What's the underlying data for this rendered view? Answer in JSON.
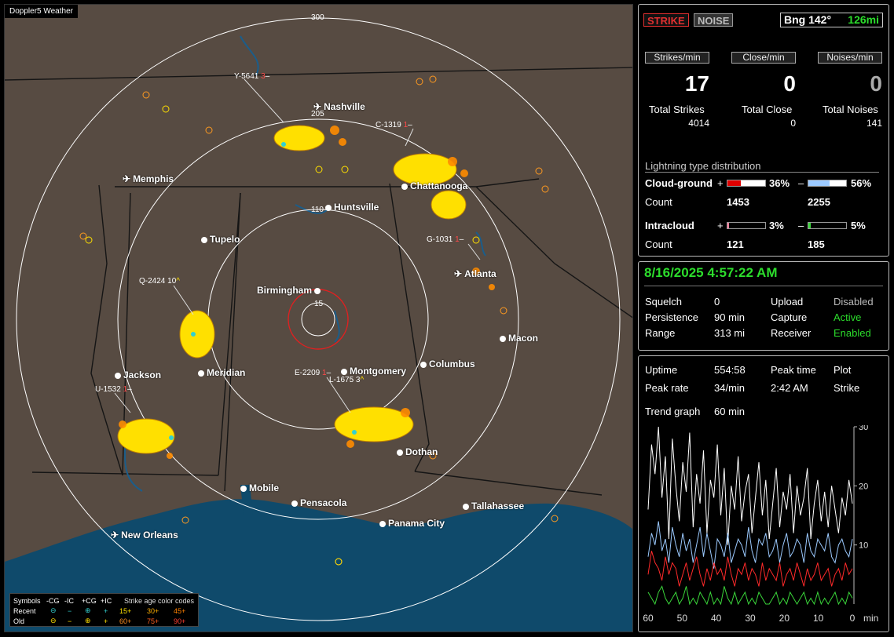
{
  "app": {
    "title": "Doppler5 Weather"
  },
  "map": {
    "ring_labels": {
      "r15": "15",
      "r110": "110",
      "r205": "205",
      "r300": "300"
    },
    "cities": [
      {
        "name": "Nashville",
        "icon": "airport-icon"
      },
      {
        "name": "Memphis",
        "icon": "airport-icon"
      },
      {
        "name": "Chattanooga",
        "icon": "city-dot"
      },
      {
        "name": "Huntsville",
        "icon": "city-dot"
      },
      {
        "name": "Tupelo",
        "icon": "city-dot"
      },
      {
        "name": "Birmingham",
        "icon": "city-dot"
      },
      {
        "name": "Atlanta",
        "icon": "airport-icon"
      },
      {
        "name": "Macon",
        "icon": "city-dot"
      },
      {
        "name": "Jackson",
        "icon": "city-dot"
      },
      {
        "name": "Meridian",
        "icon": "city-dot"
      },
      {
        "name": "Montgomery",
        "icon": "city-dot"
      },
      {
        "name": "Columbus",
        "icon": "city-dot"
      },
      {
        "name": "Dothan",
        "icon": "city-dot"
      },
      {
        "name": "Mobile",
        "icon": "city-dot"
      },
      {
        "name": "Pensacola",
        "icon": "city-dot"
      },
      {
        "name": "Tallahassee",
        "icon": "city-dot"
      },
      {
        "name": "Panama City",
        "icon": "city-dot"
      },
      {
        "name": "New Orleans",
        "icon": "airport-icon"
      }
    ],
    "storms": [
      {
        "id": "Y-5641",
        "count": "3",
        "trend": "–"
      },
      {
        "id": "C-1319",
        "count": "1",
        "trend": "–"
      },
      {
        "id": "G-1031",
        "count": "1",
        "trend": "–"
      },
      {
        "id": "Q-2424",
        "count": "10",
        "trend": "^"
      },
      {
        "id": "E-2209",
        "count": "1",
        "trend": "–"
      },
      {
        "id": "L-1675",
        "count": "3",
        "trend": "^"
      },
      {
        "id": "U-1532",
        "count": "1",
        "trend": "–"
      }
    ],
    "legend": {
      "symbols_label": "Symbols",
      "cols": [
        "-CG",
        "-IC",
        "+CG",
        "+IC"
      ],
      "title": "Strike age color codes",
      "recent_label": "Recent",
      "old_label": "Old",
      "recent_ages": [
        "15+",
        "30+",
        "45+"
      ],
      "old_ages": [
        "60+",
        "75+",
        "90+"
      ]
    }
  },
  "status": {
    "strike_btn": "STRIKE",
    "noise_btn": "NOISE",
    "bearing": "Bng 142°",
    "distance": "126mi",
    "strikes_per_min_label": "Strikes/min",
    "close_per_min_label": "Close/min",
    "noises_per_min_label": "Noises/min",
    "strikes_per_min": "17",
    "close_per_min": "0",
    "noises_per_min": "0",
    "total_strikes_label": "Total Strikes",
    "total_close_label": "Total Close",
    "total_noises_label": "Total Noises",
    "total_strikes": "4014",
    "total_close": "0",
    "total_noises": "141",
    "dist_title": "Lightning type distribution",
    "cg_label": "Cloud-ground",
    "ic_label": "Intracloud",
    "count_label": "Count",
    "plus": "+",
    "minus": "–",
    "cg_pos_pct": "36%",
    "cg_neg_pct": "56%",
    "cg_pos_count": "1453",
    "cg_neg_count": "2255",
    "ic_pos_pct": "3%",
    "ic_neg_pct": "5%",
    "ic_pos_count": "121",
    "ic_neg_count": "185",
    "cg_pos_frac": 0.36,
    "cg_neg_frac": 0.56,
    "ic_pos_frac": 0.03,
    "ic_neg_frac": 0.05
  },
  "settings": {
    "datetime": "8/16/2025 4:57:22 AM",
    "squelch_label": "Squelch",
    "squelch": "0",
    "persistence_label": "Persistence",
    "persistence": "90 min",
    "range_label": "Range",
    "range": "313 mi",
    "upload_label": "Upload",
    "upload": "Disabled",
    "capture_label": "Capture",
    "capture": "Active",
    "receiver_label": "Receiver",
    "receiver": "Enabled"
  },
  "trend": {
    "uptime_label": "Uptime",
    "uptime": "554:58",
    "peak_time_label": "Peak time",
    "peak_time": "2:42 AM",
    "plot_label": "Plot",
    "plot": "Strike",
    "peak_rate_label": "Peak rate",
    "peak_rate": "34/min",
    "trend_graph_label": "Trend graph",
    "trend_graph": "60 min"
  },
  "chart_data": {
    "type": "line",
    "x_ticks": [
      "60",
      "50",
      "40",
      "30",
      "20",
      "10",
      "0"
    ],
    "x_unit": "min",
    "y_ticks": [
      "10",
      "20",
      "30"
    ],
    "ylim": [
      0,
      30
    ],
    "xlim": [
      60,
      0
    ],
    "series": [
      {
        "color": "#ffffff",
        "values": [
          16,
          27,
          22,
          30,
          18,
          25,
          11,
          28,
          20,
          14,
          24,
          19,
          29,
          13,
          22,
          17,
          26,
          12,
          21,
          18,
          27,
          15,
          23,
          10,
          20,
          16,
          25,
          14,
          19,
          22,
          12,
          18,
          24,
          15,
          21,
          11,
          17,
          23,
          13,
          19,
          16,
          22,
          12,
          20,
          15,
          18,
          23,
          11,
          17,
          21,
          14,
          19,
          13,
          20,
          16,
          12,
          18,
          15,
          21,
          17
        ]
      },
      {
        "color": "#9ccaff",
        "values": [
          8,
          12,
          10,
          14,
          9,
          11,
          7,
          13,
          10,
          8,
          12,
          9,
          11,
          7,
          10,
          13,
          8,
          12,
          9,
          6,
          11,
          10,
          8,
          12,
          7,
          9,
          11,
          10,
          8,
          13,
          9,
          7,
          11,
          10,
          12,
          8,
          9,
          11,
          7,
          10,
          12,
          8,
          9,
          11,
          10,
          7,
          12,
          9,
          8,
          11,
          10,
          9,
          12,
          8,
          7,
          10,
          11,
          9,
          8,
          11
        ]
      },
      {
        "color": "#ff2a2a",
        "values": [
          5,
          9,
          7,
          6,
          4,
          8,
          5,
          7,
          6,
          3,
          5,
          7,
          4,
          6,
          8,
          5,
          3,
          6,
          4,
          7,
          5,
          6,
          4,
          8,
          5,
          3,
          6,
          5,
          7,
          4,
          6,
          5,
          3,
          7,
          4,
          6,
          5,
          4,
          7,
          3,
          5,
          6,
          4,
          7,
          5,
          3,
          6,
          4,
          5,
          7,
          4,
          5,
          6,
          3,
          5,
          6,
          4,
          7,
          5,
          6
        ]
      },
      {
        "color": "#3ad63a",
        "values": [
          2,
          1,
          0,
          2,
          3,
          1,
          0,
          1,
          2,
          0,
          1,
          3,
          0,
          1,
          0,
          2,
          1,
          0,
          2,
          0,
          1,
          0,
          3,
          1,
          0,
          2,
          0,
          1,
          2,
          0,
          1,
          0,
          2,
          1,
          0,
          0,
          1,
          2,
          0,
          1,
          0,
          2,
          1,
          0,
          1,
          2,
          0,
          1,
          0,
          2,
          0,
          1,
          0,
          1,
          2,
          0,
          1,
          0,
          2,
          1
        ]
      }
    ]
  }
}
